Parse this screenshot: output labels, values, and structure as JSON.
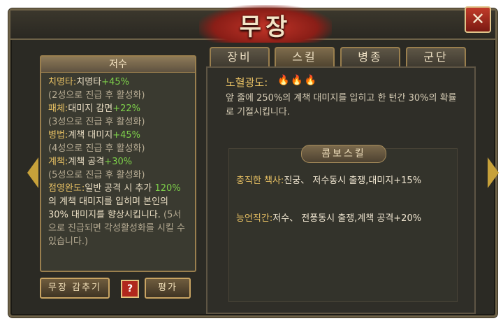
{
  "title": "무장",
  "close_icon": "x-icon",
  "left": {
    "header": "저수",
    "lines": [
      {
        "a": "치명타:",
        "b": "치명타",
        "c": "+45%"
      },
      {
        "note": "(2성으로 진급 후 활성화)"
      },
      {
        "a": "패체:",
        "b": "대미지 감면",
        "c": "+22%"
      },
      {
        "note": "(3성으로 진급 후 활성화)"
      },
      {
        "a": "병법:",
        "b": "계책 대미지",
        "c": "+45%"
      },
      {
        "note": "(4성으로 진급 후 활성화)"
      },
      {
        "a": "계책:",
        "b": "계책 공격",
        "c": "+30%"
      },
      {
        "note": "(5성으로 진급 후 활성화)"
      }
    ],
    "ability_name": "점영완도:",
    "ability_text_1": "일반 공격 시 추가",
    "ability_highlight": "120%",
    "ability_text_2": "의 계책 대미지를 입히며 본인의 30% 대미지를 향상시킵니다.",
    "ability_note": "(5서으로 진급되면 각성활성화를 시킬 수 있습니다.)"
  },
  "buttons": {
    "hide": "무장 감추기",
    "help": "?",
    "rate": "평가"
  },
  "tabs": [
    "장비",
    "스킬",
    "병종",
    "군단"
  ],
  "active_tab": "스킬",
  "skill": {
    "name": "노혈광도:",
    "flames": "🔥🔥🔥",
    "desc": "앞 줄에 250%의 계책 대미지를 입히고 한 턴간 30%의 확률로 기절시킵니다."
  },
  "combo": {
    "title": "콤보스킬",
    "items": [
      {
        "name": "충직한 책사:",
        "text": "진궁、 저수동시 출쟁,대미지+15%"
      },
      {
        "name": "능언직간:",
        "text": "저수、 전풍동시 출쟁,계책 공격+20%"
      }
    ]
  }
}
